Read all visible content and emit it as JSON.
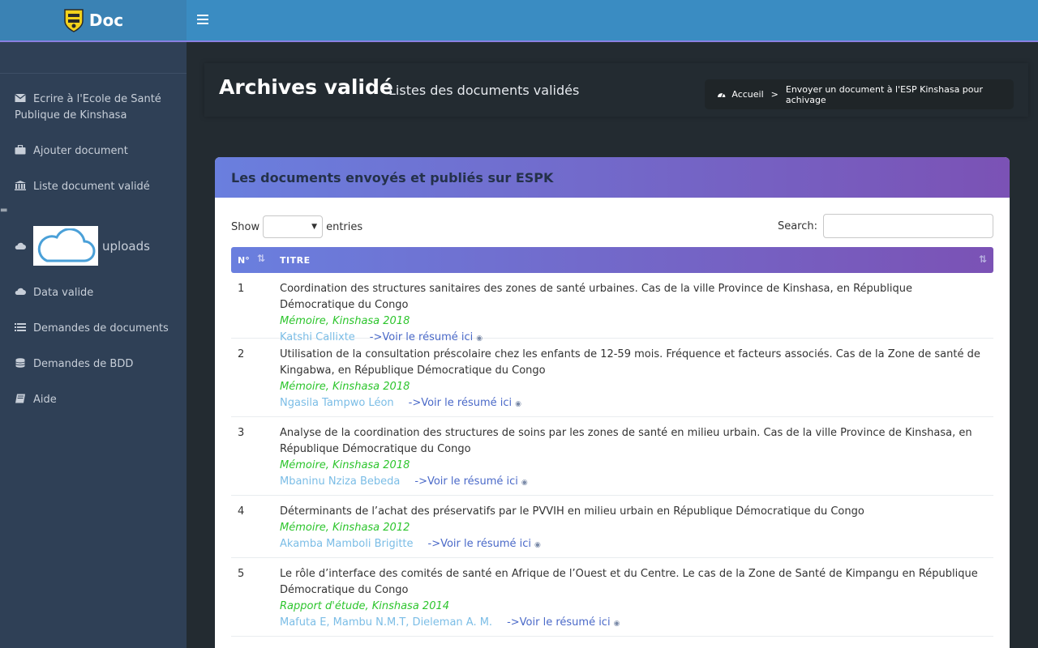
{
  "header": {
    "brand": "Doc"
  },
  "sidebar": {
    "items": [
      {
        "label": "Ecrire à l'Ecole de Santé Publique de Kinshasa"
      },
      {
        "label": "Ajouter document"
      },
      {
        "label": "Liste document validé"
      },
      {
        "label": "uploads"
      },
      {
        "label": "Data valide"
      },
      {
        "label": "Demandes de documents"
      },
      {
        "label": "Demandes de BDD"
      },
      {
        "label": "Aide"
      }
    ]
  },
  "page": {
    "title": "Archives validé",
    "subtitle": "Listes des documents validés"
  },
  "breadcrumb": {
    "home": "Accueil",
    "separator": ">",
    "current": "Envoyer un document à l'ESP Kinshasa pour achivage"
  },
  "card": {
    "title": "Les documents envoyés et publiés sur ESPK",
    "show_label": "Show",
    "entries_label": "entries",
    "search_label": "Search:",
    "columns": {
      "no": "N°",
      "title": "TITRE"
    }
  },
  "rows": [
    {
      "no": "1",
      "title": "Coordination des structures sanitaires des zones de santé urbaines. Cas de la ville Province de Kinshasa, en République Démocratique du Congo",
      "meta": "Mémoire, Kinshasa 2018",
      "author": "Katshi Callixte",
      "link": "->Voir le résumé ici"
    },
    {
      "no": "2",
      "title": "Utilisation de la consultation préscolaire chez les enfants de 12-59 mois. Fréquence et facteurs associés. Cas de la Zone de santé de Kingabwa, en République Démocratique du Congo",
      "meta": "Mémoire, Kinshasa 2018",
      "author": "Ngasila Tampwo Léon",
      "link": "->Voir le résumé ici"
    },
    {
      "no": "3",
      "title": "Analyse de la coordination des structures de soins par les zones de santé en milieu urbain. Cas de la ville Province de Kinshasa, en République Démocratique du Congo",
      "meta": "Mémoire, Kinshasa 2018",
      "author": "Mbaninu Nziza Bebeda",
      "link": "->Voir le résumé ici"
    },
    {
      "no": "4",
      "title": "Déterminants de l’achat des préservatifs par le PVVIH en milieu urbain en République Démocratique du Congo",
      "meta": "Mémoire, Kinshasa 2012",
      "author": "Akamba Mamboli Brigitte",
      "link": "->Voir le résumé ici"
    },
    {
      "no": "5",
      "title": "Le rôle d’interface des comités de santé en Afrique de l’Ouest et du Centre. Le cas de la Zone de Santé de Kimpangu en République Démocratique du Congo",
      "meta": "Rapport d'étude, Kinshasa 2014",
      "author": "Mafuta E, Mambu N.M.T, Dieleman A. M.",
      "link": "->Voir le résumé ici"
    }
  ]
}
